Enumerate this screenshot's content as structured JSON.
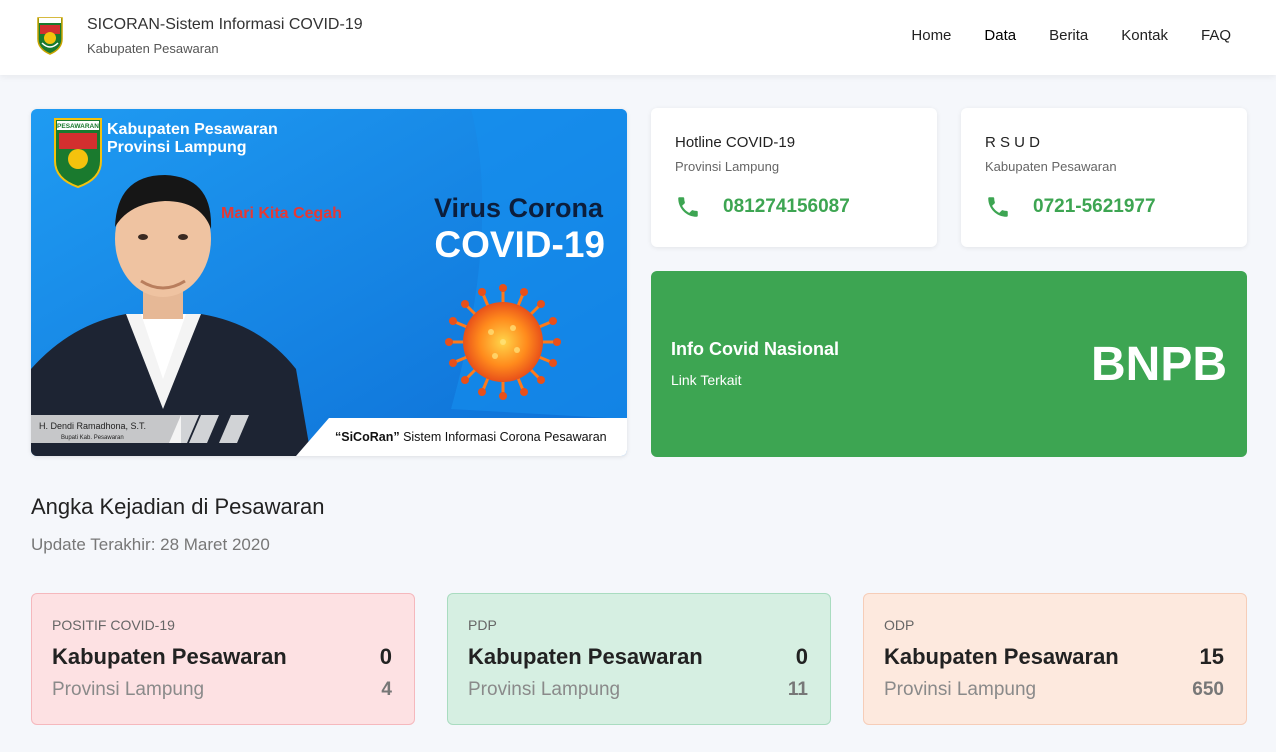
{
  "header": {
    "title": "SICORAN-Sistem Informasi COVID-19",
    "subtitle": "Kabupaten Pesawaran",
    "nav": [
      "Home",
      "Data",
      "Berita",
      "Kontak",
      "FAQ"
    ]
  },
  "banner": {
    "line1": "Kabupaten Pesawaran",
    "line2": "Provinsi Lampung",
    "tagline_red": "Mari Kita Cegah",
    "tagline_dark": "Virus Corona",
    "headline": "COVID-19",
    "person_name": "H. Dendi Ramadhona, S.T.",
    "person_role": "Bupati Kab. Pesawaran",
    "footer_name": "“SiCoRan”",
    "footer_rest": " Sistem Informasi Corona Pesawaran",
    "seal_text": "PESAWARAN"
  },
  "hotline": {
    "title": "Hotline COVID-19",
    "sub": "Provinsi Lampung",
    "number": "081274156087"
  },
  "rsud": {
    "title": "R S U D",
    "sub": "Kabupaten Pesawaran",
    "number": "0721-5621977"
  },
  "bnpb": {
    "title": "Info Covid Nasional",
    "sub": "Link Terkait",
    "big": "BNPB"
  },
  "section": {
    "title": "Angka Kejadian di Pesawaran",
    "updated": "Update Terakhir: 28 Maret 2020"
  },
  "stats": [
    {
      "label": "POSITIF COVID-19",
      "r1": "Kabupaten Pesawaran",
      "v1": "0",
      "r2": "Provinsi Lampung",
      "v2": "4"
    },
    {
      "label": "PDP",
      "r1": "Kabupaten Pesawaran",
      "v1": "0",
      "r2": "Provinsi Lampung",
      "v2": "11"
    },
    {
      "label": "ODP",
      "r1": "Kabupaten Pesawaran",
      "v1": "15",
      "r2": "Provinsi Lampung",
      "v2": "650"
    }
  ],
  "colors": {
    "green": "#3da552",
    "positif_bg": "#fde1e3",
    "pdp_bg": "#d6efe2",
    "odp_bg": "#fde9de"
  }
}
